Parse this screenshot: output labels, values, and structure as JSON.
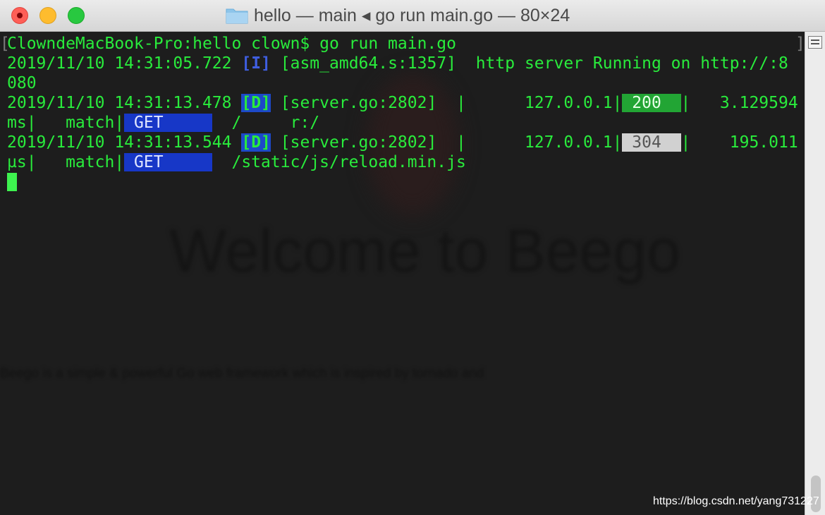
{
  "window": {
    "title": "hello — main ◂ go run main.go — 80×24"
  },
  "background_page": {
    "heading": "Welcome to Beego",
    "body_text": "Beego is a simple & powerful Go web framework which is inspired by tornado and"
  },
  "terminal": {
    "prompt_line": "ClowndeMacBook-Pro:hello clown$ go run main.go",
    "log_info": {
      "timestamp": "2019/11/10 14:31:05.722",
      "level": "[I]",
      "source": "[asm_amd64.s:1357]",
      "message_a": "  http server Running on http://:8",
      "message_b": "080"
    },
    "log_req1": {
      "timestamp": "2019/11/10 14:31:13.478",
      "level": "[D]",
      "source": "[server.go:2802]",
      "sep1": "  |      127.0.0.1|",
      "status": " 200  ",
      "sep2": "|   3.129594",
      "unit": "ms|   match|",
      "method": " GET     ",
      "path": "  /     r:/"
    },
    "log_req2": {
      "timestamp": "2019/11/10 14:31:13.544",
      "level": "[D]",
      "source": "[server.go:2802]",
      "sep1": "  |      127.0.0.1|",
      "status": " 304  ",
      "sep2": "|    195.011",
      "unit": "µs|   match|",
      "method": " GET     ",
      "path": "  /static/js/reload.min.js"
    }
  },
  "watermark": "https://blog.csdn.net/yang731227",
  "colors": {
    "terminal_text": "#29ec3c",
    "terminal_bg": "#1d1d1d",
    "status_200": "#22a534",
    "status_304": "#d1d1d1",
    "method_bg": "#1737c7"
  }
}
